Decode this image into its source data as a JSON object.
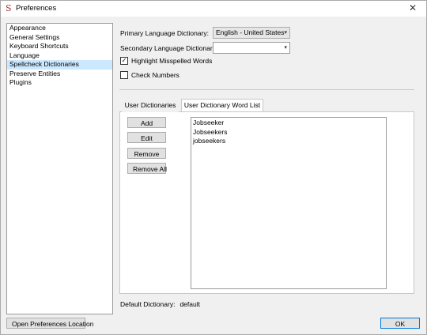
{
  "window": {
    "title": "Preferences",
    "app_icon": "S",
    "close_glyph": "✕"
  },
  "nav": {
    "items": [
      {
        "label": "Appearance",
        "selected": false
      },
      {
        "label": "General Settings",
        "selected": false
      },
      {
        "label": "Keyboard Shortcuts",
        "selected": false
      },
      {
        "label": "Language",
        "selected": false
      },
      {
        "label": "Spellcheck Dictionaries",
        "selected": true
      },
      {
        "label": "Preserve Entities",
        "selected": false
      },
      {
        "label": "Plugins",
        "selected": false
      }
    ]
  },
  "settings": {
    "primary_label": "Primary Language Dictionary:",
    "primary_value": "English - United States",
    "secondary_label": "Secondary Language Dictionary:",
    "secondary_value": "",
    "highlight_label": "Highlight Misspelled Words",
    "highlight_checked": true,
    "check_numbers_label": "Check Numbers",
    "check_numbers_checked": false,
    "check_mark": "✓",
    "dropdown_arrow": "▾"
  },
  "tabs": [
    {
      "label": "User Dictionaries",
      "active": false
    },
    {
      "label": "User Dictionary Word List",
      "active": true
    }
  ],
  "wordlist": {
    "buttons": {
      "add": "Add",
      "edit": "Edit",
      "remove": "Remove",
      "remove_all": "Remove All"
    },
    "words": [
      "Jobseeker",
      "Jobseekers",
      "jobseekers"
    ]
  },
  "footer": {
    "default_label": "Default Dictionary:",
    "default_value": "default",
    "open_location_label": "Open Preferences Location",
    "ok_label": "OK"
  },
  "colors": {
    "selected_nav_bg": "#cce8ff",
    "ok_border": "#0078d7"
  }
}
